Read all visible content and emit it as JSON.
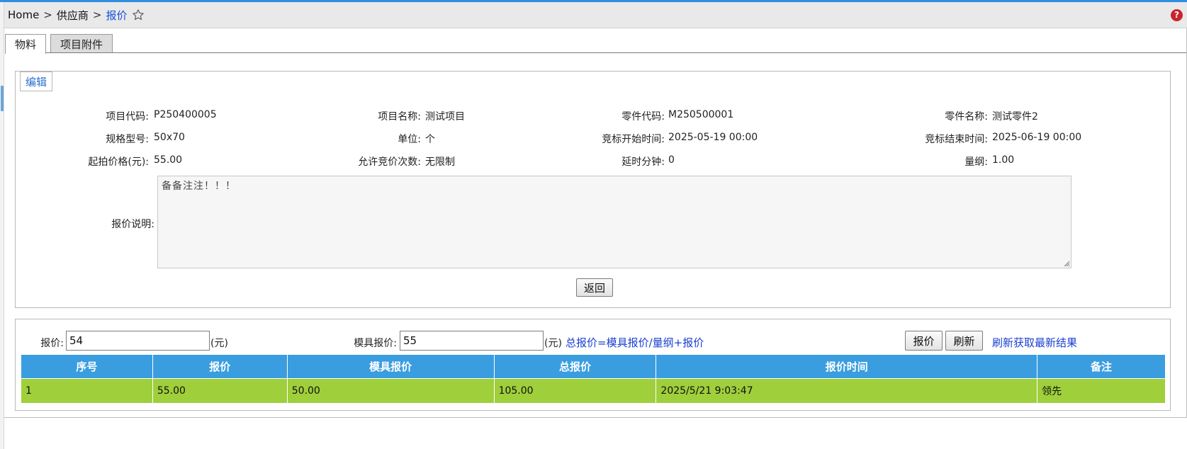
{
  "breadcrumb": {
    "home": "Home",
    "separator": ">",
    "section": "供应商",
    "current": "报价"
  },
  "tabs": [
    {
      "label": "物料",
      "active": true
    },
    {
      "label": "项目附件",
      "active": false
    }
  ],
  "edit_section": {
    "legend": "编辑",
    "fields": {
      "project_code": {
        "label": "项目代码:",
        "value": "P250400005"
      },
      "project_name": {
        "label": "项目名称:",
        "value": "测试项目"
      },
      "part_code": {
        "label": "零件代码:",
        "value": "M250500001"
      },
      "part_name": {
        "label": "零件名称:",
        "value": "测试零件2"
      },
      "spec": {
        "label": "规格型号:",
        "value": "50x70"
      },
      "unit": {
        "label": "单位:",
        "value": "个"
      },
      "bid_start": {
        "label": "竞标开始时间:",
        "value": "2025-05-19 00:00"
      },
      "bid_end": {
        "label": "竞标结束时间:",
        "value": "2025-06-19 00:00"
      },
      "start_price": {
        "label": "起拍价格(元):",
        "value": "55.00"
      },
      "allowed_bids": {
        "label": "允许竞价次数:",
        "value": "无限制"
      },
      "delay_minutes": {
        "label": "延时分钟:",
        "value": "0"
      },
      "quantity": {
        "label": "量纲:",
        "value": "1.00"
      }
    },
    "remark_label": "报价说明:",
    "remark_value": "备备注注！！！",
    "back_button": "返回"
  },
  "quote_section": {
    "price_label": "报价:",
    "price_value": "54",
    "price_unit": "(元)",
    "mold_label": "模具报价:",
    "mold_value": "55",
    "mold_unit": "(元)",
    "formula": "总报价=模具报价/量纲+报价",
    "quote_button": "报价",
    "refresh_button": "刷新",
    "refresh_link": "刷新获取最新结果"
  },
  "table": {
    "headers": [
      "序号",
      "报价",
      "模具报价",
      "总报价",
      "报价时间",
      "备注"
    ],
    "rows": [
      [
        "1",
        "55.00",
        "50.00",
        "105.00",
        "2025/5/21 9:03:47",
        "领先"
      ]
    ]
  },
  "colors": {
    "header_bg": "#3a9de0",
    "row_lead_bg": "#9fcf3a",
    "link": "#1a3fd0",
    "help_icon": "#c9242b"
  }
}
